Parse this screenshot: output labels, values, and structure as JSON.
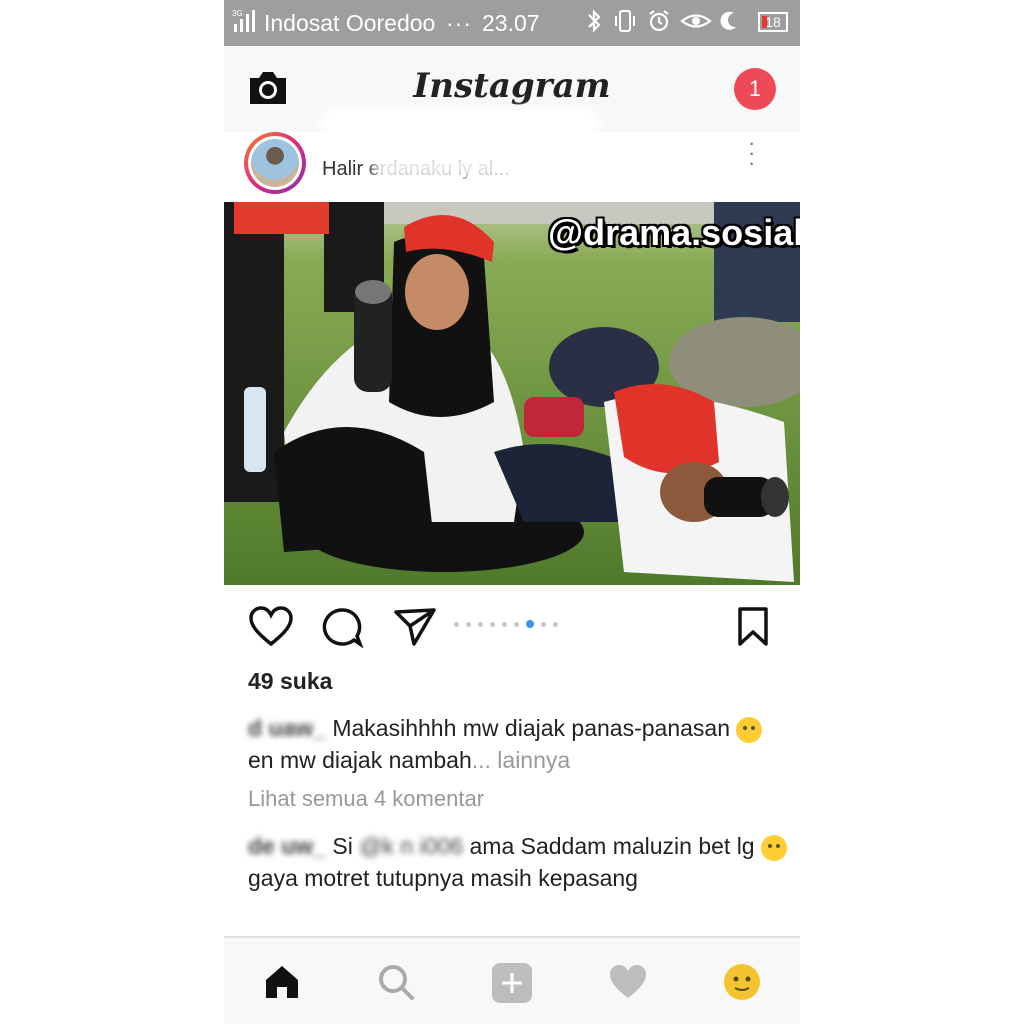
{
  "status_bar": {
    "signal": "3G",
    "carrier": "Indosat Ooredoo",
    "dots": "···",
    "time": "23.07",
    "battery": "18"
  },
  "header": {
    "app_title": "Instagram",
    "notification_count": "1"
  },
  "post": {
    "username": "Halir   erdanaku       ly      al...",
    "watermark": "@drama.sosialmedia",
    "likes": "49 suka",
    "caption_user": "d       uaw_",
    "caption_text_1": " Makasihhhh mw diajak panas-panasan ",
    "caption_text_2": " en mw diajak nambah",
    "caption_more": "... lainnya",
    "view_all_comments": "Lihat semua 4 komentar",
    "comment_user": "de        uw_",
    "comment_si": " Si ",
    "comment_mention": "@k      n     i006",
    "comment_text_1": " ama Saddam maluzin bet lg ",
    "comment_text_2": " gaya motret tutupnya masih kepasang",
    "carousel_dots": 9,
    "carousel_active_index": 6
  },
  "colors": {
    "accent_red": "#ed4956",
    "link_blue": "#003569",
    "active_dot": "#3897f0",
    "status_bar": "#9e9e9e"
  }
}
